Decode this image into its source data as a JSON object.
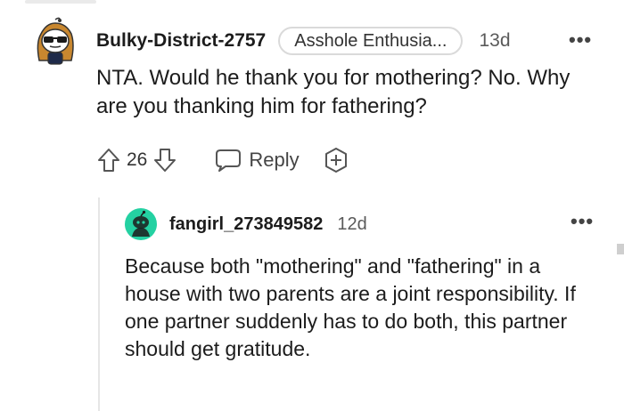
{
  "parent_comment": {
    "username": "Bulky-District-2757",
    "flair": "Asshole Enthusia...",
    "timestamp": "13d",
    "more_icon": "more-horizontal-icon",
    "body": "NTA. Would he thank you for mothering? No. Why are you thanking him for fathering?",
    "actions": {
      "upvote_icon": "arrow-up-icon",
      "vote_count": "26",
      "downvote_icon": "arrow-down-icon",
      "reply_icon": "chat-bubble-icon",
      "reply_label": "Reply",
      "award_icon": "award-plus-icon"
    }
  },
  "reply_comment": {
    "username": "fangirl_273849582",
    "timestamp": "12d",
    "more_icon": "more-horizontal-icon",
    "body": "Because both \"mothering\" and \"fathering\" in a house with two parents are a joint responsibility. If one partner suddenly has to do both, this partner should get gratitude."
  },
  "colors": {
    "text": "#1c1c1c",
    "meta": "#5a5a5a",
    "flair_border": "#dadada",
    "thread_line": "#e6e6e6",
    "reply_avatar": "#24d1a2"
  }
}
